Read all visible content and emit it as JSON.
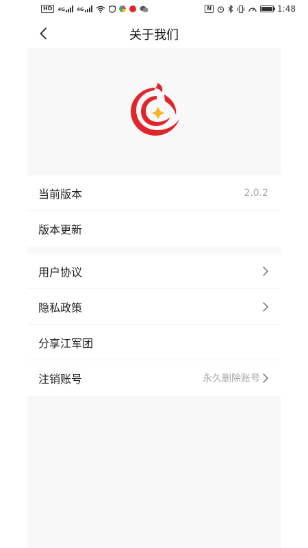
{
  "status_bar": {
    "hd_label": "HD",
    "signal1_label": "4G",
    "signal2_label": "4G",
    "nfc_label": "N",
    "time": "1:48"
  },
  "header": {
    "title": "关于我们"
  },
  "colors": {
    "brand_red": "#e0262a",
    "brand_gold": "#f3b61f",
    "panel_bg": "#f8f8f8",
    "muted_text": "#a6a6a6"
  },
  "sections": {
    "version": {
      "current_version_label": "当前版本",
      "current_version_value": "2.0.2",
      "update_label": "版本更新"
    },
    "info": {
      "user_agreement_label": "用户协议",
      "privacy_policy_label": "隐私政策",
      "share_label": "分享江军团",
      "cancel_account_label": "注销账号",
      "cancel_account_value": "永久删除账号"
    }
  }
}
